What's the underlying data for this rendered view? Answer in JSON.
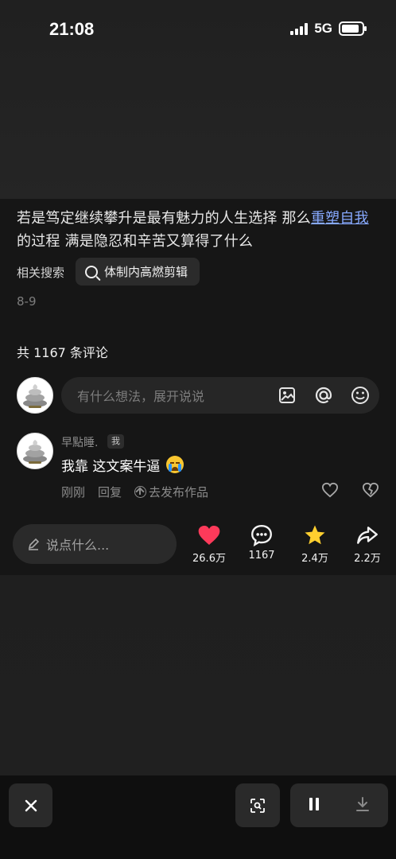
{
  "status": {
    "time": "21:08",
    "network": "5G"
  },
  "caption": {
    "part1": "若是笃定继续攀升是最有魅力的人生选择 那么",
    "link": "重塑自我",
    "part2": "的过程 满是隐忍和辛苦又算得了什么"
  },
  "related": {
    "label": "相关搜索",
    "query": "体制内高燃剪辑"
  },
  "date": "8-9",
  "comments": {
    "count_text": "共 1167 条评论",
    "input_placeholder": "有什么想法，展开说说",
    "item": {
      "author": "早點睡.",
      "badge": "我",
      "text": "我靠 这文案牛逼",
      "time": "刚刚",
      "reply": "回复",
      "publish": "去发布作品"
    }
  },
  "bottom_actions": {
    "say_placeholder": "说点什么...",
    "like_count": "26.6万",
    "comment_count": "1167",
    "favorite_count": "2.4万",
    "share_count": "2.2万"
  },
  "colors": {
    "like": "#fd3a5a",
    "favorite": "#ffcf2f",
    "link": "#87a9ff",
    "background": "#161616"
  },
  "icons": [
    "image-icon",
    "at-icon",
    "emoji-icon",
    "heart-icon",
    "broken-heart-icon",
    "pencil-icon",
    "comment-bubble-icon",
    "star-icon",
    "share-arrow-icon",
    "close-icon",
    "scan-icon",
    "pause-icon",
    "download-icon"
  ]
}
